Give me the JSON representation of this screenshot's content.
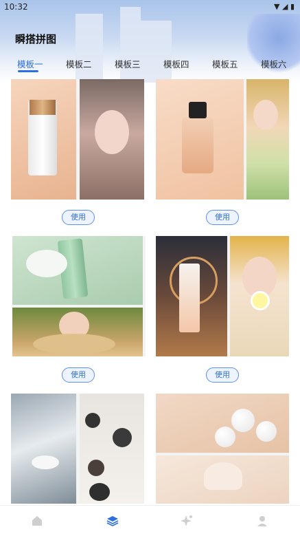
{
  "status": {
    "time": "10:32",
    "icons": "▼ ◢ ▮"
  },
  "header": {
    "title": "瞬搭拼图"
  },
  "tabs": [
    {
      "label": "模板一"
    },
    {
      "label": "模板二"
    },
    {
      "label": "模板三"
    },
    {
      "label": "模板四"
    },
    {
      "label": "模板五"
    },
    {
      "label": "模板六"
    }
  ],
  "templates": [
    {
      "use_label": "使用"
    },
    {
      "use_label": "使用"
    },
    {
      "use_label": "使用"
    },
    {
      "use_label": "使用"
    }
  ],
  "colors": {
    "accent": "#2e6fe0"
  },
  "bottom_nav": [
    {
      "icon": "home-icon"
    },
    {
      "icon": "layers-icon"
    },
    {
      "icon": "sparkle-icon"
    },
    {
      "icon": "user-icon"
    }
  ]
}
